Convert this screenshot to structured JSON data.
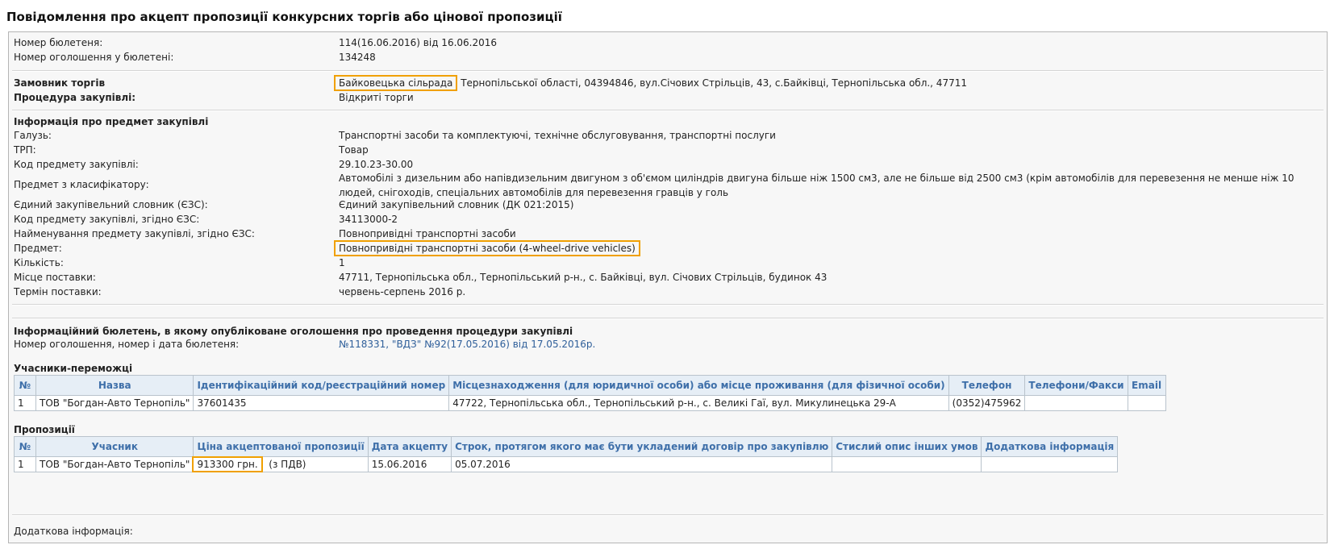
{
  "title": "Повідомлення про акцепт пропозиції конкурсних торгів або цінової пропозиції",
  "bulletin": {
    "number_label": "Номер бюлетеня:",
    "number_value": "114(16.06.2016) від 16.06.2016",
    "announcement_label": "Номер оголошення у бюлетені:",
    "announcement_value": "134248"
  },
  "customer": {
    "label": "Замовник торгів",
    "name": "Байковецька сільрада",
    "rest": "Тернопільської області, 04394846, вул.Січових Стрільців, 43, с.Байківці, Тернопільська обл., 47711",
    "procedure_label": "Процедура закупівлі:",
    "procedure_value": "Відкриті торги"
  },
  "subject": {
    "heading": "Інформація про предмет закупівлі",
    "rows": [
      {
        "label": "Галузь:",
        "value": "Транспортні засоби та комплектуючі, технічне обслуговування, транспортні послуги"
      },
      {
        "label": "ТРП:",
        "value": "Товар"
      },
      {
        "label": "Код предмету закупівлі:",
        "value": "29.10.23-30.00"
      }
    ],
    "classifier_label": "Предмет з класифікатору:",
    "classifier_value": "Автомобілі з дизельним або напівдизельним двигуном з об'ємом циліндрів двигуна більше ніж 1500 см3, але не більше від 2500 см3 (крім автомобілів для перевезення не менше ніж 10 людей, снігоходів, спеціальних автомобілів для перевезення гравців у голь",
    "rows2": [
      {
        "label": "Єдиний закупівельний словник (ЄЗС):",
        "value": "Єдиний закупівельний словник (ДК 021:2015)"
      },
      {
        "label": "Код предмету закупівлі, згідно ЄЗС:",
        "value": "34113000-2"
      },
      {
        "label": "Найменування предмету закупівлі, згідно ЄЗС:",
        "value": "Повнопривідні транспортні засоби"
      }
    ],
    "item_label": "Предмет:",
    "item_value": "Повнопривідні транспортні засоби (4-wheel-drive vehicles)",
    "rows3": [
      {
        "label": "Кількість:",
        "value": "1"
      },
      {
        "label": "Місце поставки:",
        "value": "47711, Тернопільська обл., Тернопільський р-н., с. Байківці, вул. Січових Стрільців, будинок 43"
      },
      {
        "label": "Термін поставки:",
        "value": "червень-серпень 2016 р."
      }
    ]
  },
  "info_bulletin": {
    "heading": "Інформаційний бюлетень, в якому опубліковане оголошення про проведення процедури закупівлі",
    "label": "Номер оголошення, номер і дата бюлетеня:",
    "link": "№118331, \"ВДЗ\" №92(17.05.2016) від 17.05.2016р."
  },
  "winners": {
    "heading": "Учасники-переможці",
    "columns": [
      "№",
      "Назва",
      "Ідентифікаційний код/реєстраційний номер",
      "Місцезнаходження (для юридичної особи) або місце проживання (для фізичної особи)",
      "Телефон",
      "Телефони/Факси",
      "Email"
    ],
    "rows": [
      [
        "1",
        "ТОВ \"Богдан-Авто Тернопіль\"",
        "37601435",
        "47722, Тернопільська обл., Тернопільський р-н., с. Великі Гаї, вул. Микулинецька 29-А",
        "(0352)475962",
        "",
        ""
      ]
    ]
  },
  "proposals": {
    "heading": "Пропозиції",
    "columns": [
      "№",
      "Учасник",
      "Ціна акцептованої пропозиції",
      "Дата акцепту",
      "Строк, протягом якого має бути укладений договір про закупівлю",
      "Стислий опис інших умов",
      "Додаткова інформація"
    ],
    "row": {
      "num": "1",
      "participant": "ТОВ \"Богдан-Авто Тернопіль\"",
      "price": "913300 грн.",
      "vat": "(з ПДВ)",
      "date": "15.06.2016",
      "term": "05.07.2016",
      "other": "",
      "extra": ""
    }
  },
  "additional": {
    "label": "Додаткова інформація:"
  },
  "colors": {
    "highlight": "#f0a000",
    "link": "#2f5f9a",
    "table_header_text": "#3e6fa9",
    "table_header_bg": "#e6eef6"
  }
}
